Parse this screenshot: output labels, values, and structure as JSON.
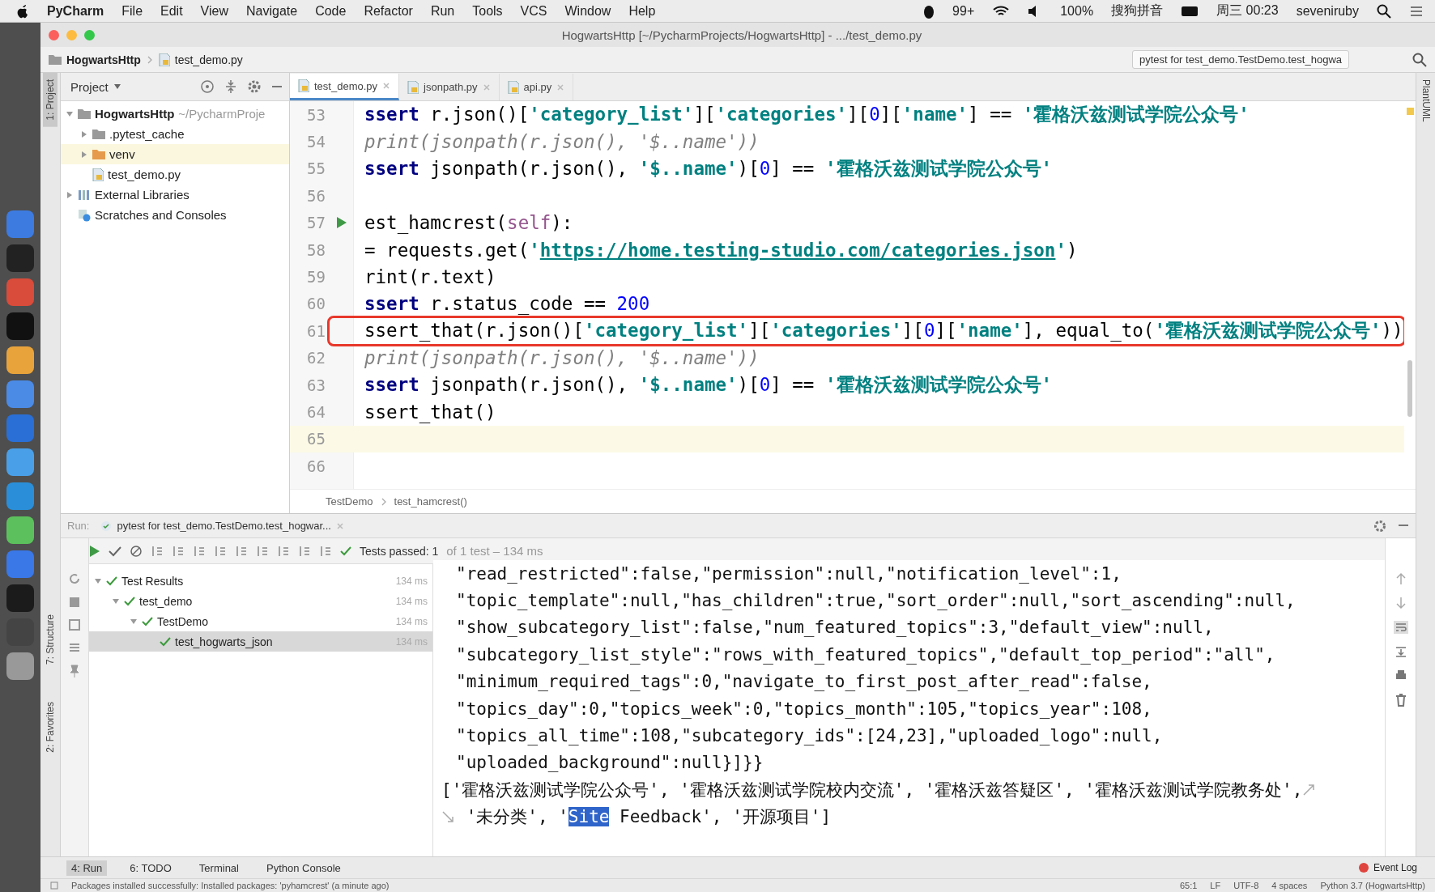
{
  "menubar": {
    "app": "PyCharm",
    "menus": [
      "File",
      "Edit",
      "View",
      "Navigate",
      "Code",
      "Refactor",
      "Run",
      "Tools",
      "VCS",
      "Window",
      "Help"
    ],
    "status_items": [
      "99+",
      "100%",
      "搜狗拼音",
      "周三 00:23",
      "seveniruby"
    ]
  },
  "window": {
    "title": "HogwartsHttp [~/PycharmProjects/HogwartsHttp] - .../test_demo.py"
  },
  "navbar": {
    "breadcrumbs": [
      "HogwartsHttp",
      "test_demo.py"
    ],
    "run_config": "pytest for test_demo.TestDemo.test_hogwa"
  },
  "tool_strip_left": [
    {
      "label": "1: Project",
      "selected": true
    },
    {
      "label": "7: Structure",
      "selected": false
    },
    {
      "label": "2: Favorites",
      "selected": false
    }
  ],
  "tool_strip_right": [
    "PlantUML"
  ],
  "project": {
    "title": "Project",
    "tree": [
      {
        "label": "HogwartsHttp",
        "path": "~/PycharmProje",
        "kind": "root",
        "expanded": true,
        "selected": false,
        "children": [
          {
            "label": ".pytest_cache",
            "kind": "folder",
            "expanded": false,
            "selected": false
          },
          {
            "label": "venv",
            "kind": "venv",
            "expanded": false,
            "selected": true
          },
          {
            "label": "test_demo.py",
            "kind": "file",
            "selected": false
          }
        ]
      },
      {
        "label": "External Libraries",
        "kind": "library",
        "expanded": false,
        "selected": false
      },
      {
        "label": "Scratches and Consoles",
        "kind": "scratch",
        "selected": false
      }
    ]
  },
  "editor": {
    "tabs": [
      {
        "label": "test_demo.py",
        "selected": true
      },
      {
        "label": "jsonpath.py",
        "selected": false
      },
      {
        "label": "api.py",
        "selected": false
      }
    ],
    "lines": [
      {
        "number": "53",
        "current": false,
        "run_marker": false,
        "boxed": false,
        "tokens": [
          {
            "kind": "keyword",
            "text": "ssert"
          },
          {
            "kind": "plain",
            "text": " r.json()["
          },
          {
            "kind": "string",
            "text": "'category_list'"
          },
          {
            "kind": "plain",
            "text": "]["
          },
          {
            "kind": "string",
            "text": "'categories'"
          },
          {
            "kind": "plain",
            "text": "]["
          },
          {
            "kind": "number",
            "text": "0"
          },
          {
            "kind": "plain",
            "text": "]["
          },
          {
            "kind": "string",
            "text": "'name'"
          },
          {
            "kind": "plain",
            "text": "] == "
          },
          {
            "kind": "string",
            "text": "'霍格沃兹测试学院公众号'"
          }
        ]
      },
      {
        "number": "54",
        "current": false,
        "run_marker": false,
        "boxed": false,
        "tokens": [
          {
            "kind": "comment",
            "text": "print(jsonpath(r.json(), '$..name'))"
          }
        ]
      },
      {
        "number": "55",
        "current": false,
        "run_marker": false,
        "boxed": false,
        "tokens": [
          {
            "kind": "keyword",
            "text": "ssert"
          },
          {
            "kind": "plain",
            "text": " jsonpath(r.json(), "
          },
          {
            "kind": "string",
            "text": "'$..name'"
          },
          {
            "kind": "plain",
            "text": ")["
          },
          {
            "kind": "number",
            "text": "0"
          },
          {
            "kind": "plain",
            "text": "] == "
          },
          {
            "kind": "string",
            "text": "'霍格沃兹测试学院公众号'"
          }
        ]
      },
      {
        "number": "56",
        "current": false,
        "run_marker": false,
        "boxed": false
      },
      {
        "number": "57",
        "current": false,
        "run_marker": true,
        "boxed": false,
        "tokens": [
          {
            "kind": "plain",
            "text": "est_hamcrest("
          },
          {
            "kind": "self",
            "text": "self"
          },
          {
            "kind": "plain",
            "text": "):"
          }
        ]
      },
      {
        "number": "58",
        "current": false,
        "run_marker": false,
        "boxed": false,
        "tokens": [
          {
            "kind": "plain",
            "text": "= requests.get("
          },
          {
            "kind": "string",
            "text": "'"
          },
          {
            "kind": "link",
            "text": "https://home.testing-studio.com/categories.json"
          },
          {
            "kind": "string",
            "text": "'"
          },
          {
            "kind": "plain",
            "text": ")"
          }
        ]
      },
      {
        "number": "59",
        "current": false,
        "run_marker": false,
        "boxed": false,
        "tokens": [
          {
            "kind": "plain",
            "text": "rint(r.text)"
          }
        ]
      },
      {
        "number": "60",
        "current": false,
        "run_marker": false,
        "boxed": false,
        "tokens": [
          {
            "kind": "keyword",
            "text": "ssert"
          },
          {
            "kind": "plain",
            "text": " r.status_code == "
          },
          {
            "kind": "number",
            "text": "200"
          }
        ]
      },
      {
        "number": "61",
        "current": false,
        "run_marker": false,
        "boxed": true,
        "tokens": [
          {
            "kind": "plain",
            "text": "ssert_that(r.json()["
          },
          {
            "kind": "string",
            "text": "'category_list'"
          },
          {
            "kind": "plain",
            "text": "]["
          },
          {
            "kind": "string",
            "text": "'categories'"
          },
          {
            "kind": "plain",
            "text": "]["
          },
          {
            "kind": "number",
            "text": "0"
          },
          {
            "kind": "plain",
            "text": "]["
          },
          {
            "kind": "string",
            "text": "'name'"
          },
          {
            "kind": "plain",
            "text": "], equal_to("
          },
          {
            "kind": "string",
            "text": "'霍格沃兹测试学院公众号'"
          },
          {
            "kind": "plain",
            "text": "))"
          }
        ]
      },
      {
        "number": "62",
        "current": false,
        "run_marker": false,
        "boxed": false,
        "tokens": [
          {
            "kind": "comment",
            "text": "print(jsonpath(r.json(), '$..name'))"
          }
        ]
      },
      {
        "number": "63",
        "current": false,
        "run_marker": false,
        "boxed": false,
        "tokens": [
          {
            "kind": "keyword",
            "text": "ssert"
          },
          {
            "kind": "plain",
            "text": " jsonpath(r.json(), "
          },
          {
            "kind": "string",
            "text": "'$..name'"
          },
          {
            "kind": "plain",
            "text": ")["
          },
          {
            "kind": "number",
            "text": "0"
          },
          {
            "kind": "plain",
            "text": "] == "
          },
          {
            "kind": "string",
            "text": "'霍格沃兹测试学院公众号'"
          }
        ]
      },
      {
        "number": "64",
        "current": false,
        "run_marker": false,
        "boxed": false,
        "tokens": [
          {
            "kind": "plain",
            "text": "ssert_that()"
          }
        ]
      },
      {
        "number": "65",
        "current": true,
        "run_marker": false,
        "boxed": false
      },
      {
        "number": "66",
        "current": false,
        "run_marker": false,
        "boxed": false
      }
    ],
    "breadcrumbs": [
      "TestDemo",
      "test_hamcrest()"
    ]
  },
  "run": {
    "label": "Run:",
    "tab": "pytest for test_demo.TestDemo.test_hogwar...",
    "status": {
      "passed": "Tests passed: 1",
      "detail": "of 1 test – 134 ms"
    },
    "tree": [
      {
        "label": "Test Results",
        "time": "134 ms",
        "expanded": true,
        "selected": false,
        "children": [
          {
            "label": "test_demo",
            "time": "134 ms",
            "expanded": true,
            "selected": false,
            "children": [
              {
                "label": "TestDemo",
                "time": "134 ms",
                "expanded": true,
                "selected": false,
                "children": [
                  {
                    "label": "test_hogwarts_json",
                    "time": "134 ms",
                    "selected": true
                  }
                ]
              }
            ]
          }
        ]
      }
    ],
    "output": [
      {
        "kind": "continuation",
        "segments": [
          {
            "text": "\"read_restricted\":false,\"permission\":null,\"notification_level\":1,",
            "selected": false
          }
        ]
      },
      {
        "kind": "continuation",
        "segments": [
          {
            "text": "\"topic_template\":null,\"has_children\":true,\"sort_order\":null,\"sort_ascending\":null,",
            "selected": false
          }
        ]
      },
      {
        "kind": "continuation",
        "segments": [
          {
            "text": "\"show_subcategory_list\":false,\"num_featured_topics\":3,\"default_view\":null,",
            "selected": false
          }
        ]
      },
      {
        "kind": "continuation",
        "segments": [
          {
            "text": "\"subcategory_list_style\":\"rows_with_featured_topics\",\"default_top_period\":\"all\",",
            "selected": false
          }
        ]
      },
      {
        "kind": "continuation",
        "segments": [
          {
            "text": "\"minimum_required_tags\":0,\"navigate_to_first_post_after_read\":false,",
            "selected": false
          }
        ]
      },
      {
        "kind": "continuation",
        "segments": [
          {
            "text": "\"topics_day\":0,\"topics_week\":0,\"topics_month\":105,\"topics_year\":108,",
            "selected": false
          }
        ]
      },
      {
        "kind": "continuation",
        "segments": [
          {
            "text": "\"topics_all_time\":108,\"subcategory_ids\":[24,23],\"uploaded_logo\":null,",
            "selected": false
          }
        ]
      },
      {
        "kind": "continuation",
        "segments": [
          {
            "text": "\"uploaded_background\":null}]}}",
            "selected": false
          }
        ]
      },
      {
        "kind": "first",
        "segments": [
          {
            "text": "['霍格沃兹测试学院公众号', '霍格沃兹测试学院校内交流', '霍格沃兹答疑区', '霍格沃兹测试学院教务处',",
            "selected": false
          }
        ]
      },
      {
        "kind": "wrapped",
        "segments": [
          {
            "text": " '未分类', '",
            "selected": false
          },
          {
            "text": "Site",
            "selected": true
          },
          {
            "text": " Feedback', '开源项目']",
            "selected": false
          }
        ]
      }
    ]
  },
  "bottom_tabs": [
    {
      "label": "4: Run",
      "selected": true
    },
    {
      "label": "6: TODO",
      "selected": false
    },
    {
      "label": "Terminal",
      "selected": false
    },
    {
      "label": "Python Console",
      "selected": false
    }
  ],
  "event_log": "Event Log",
  "status_bar": {
    "message": "Packages installed successfully: Installed packages: 'pyhamcrest' (a minute ago)",
    "items": [
      "65:1",
      "LF",
      "UTF-8",
      "4 spaces",
      "Python 3.7 (HogwartsHttp)"
    ]
  }
}
